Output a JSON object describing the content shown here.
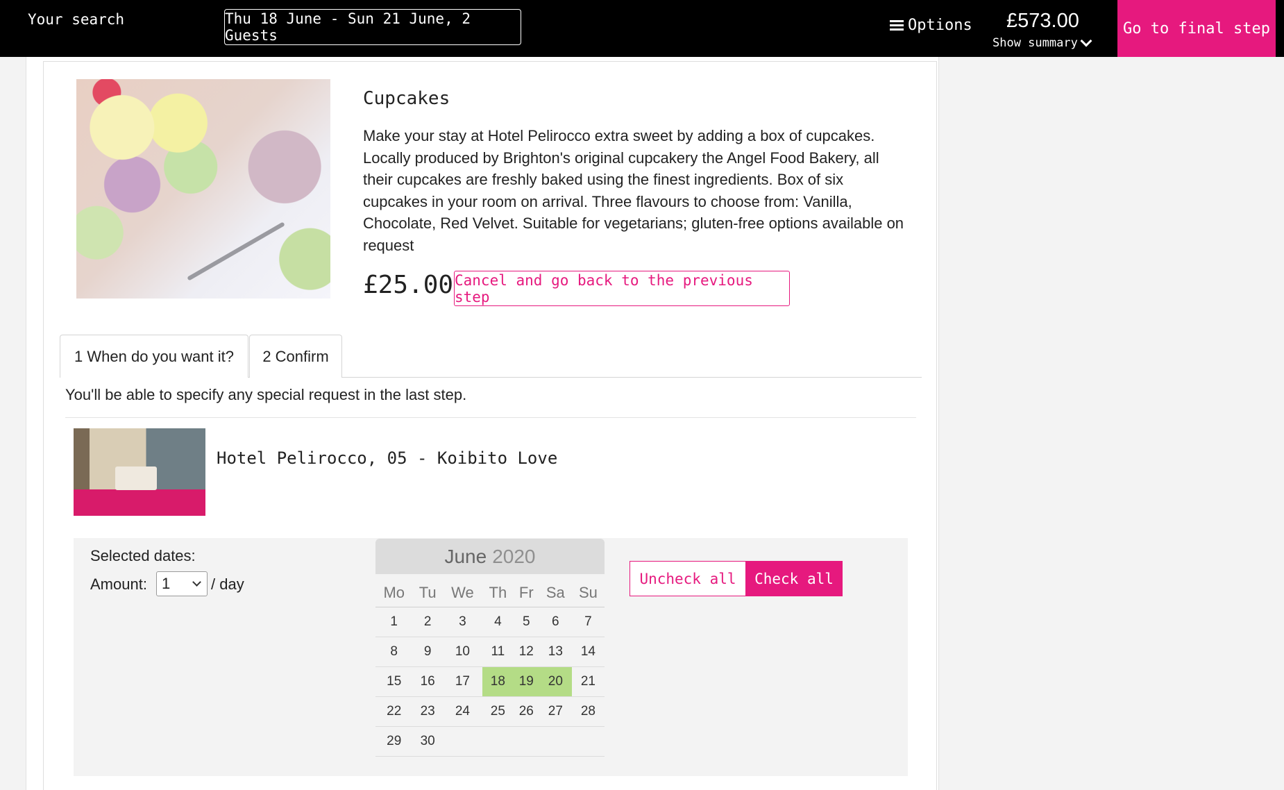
{
  "header": {
    "your_search": "Your search",
    "search_summary": "Thu 18 June - Sun 21 June, 2 Guests",
    "options_label": "Options",
    "total_price": "£573.00",
    "show_summary": "Show summary",
    "final_step": "Go to final step",
    "accent_color": "#e6197e"
  },
  "product": {
    "title": "Cupcakes",
    "description": "Make your stay at Hotel Pelirocco extra sweet by adding a box of cupcakes. Locally produced by Brighton's original cupcakery the Angel Food Bakery, all their cupcakes are freshly baked using the finest ingredients. Box of six cupcakes in your room on arrival. Three flavours to choose from: Vanilla, Chocolate, Red Velvet. Suitable for vegetarians; gluten-free options available on request",
    "price": "£25.00",
    "cancel_label": "Cancel and go back to the previous step"
  },
  "tabs": [
    {
      "label": "1 When do you want it?"
    },
    {
      "label": "2 Confirm"
    }
  ],
  "note": "You'll be able to specify any special request in the last step.",
  "room": {
    "name": "Hotel Pelirocco, 05 - Koibito Love"
  },
  "selection": {
    "selected_dates_label": "Selected dates:",
    "amount_label": "Amount:",
    "amount_value": "1",
    "per_day": "/ day"
  },
  "calendar": {
    "month": "June",
    "year": "2020",
    "weekdays": [
      "Mo",
      "Tu",
      "We",
      "Th",
      "Fr",
      "Sa",
      "Su"
    ],
    "weeks": [
      [
        "1",
        "2",
        "3",
        "4",
        "5",
        "6",
        "7"
      ],
      [
        "8",
        "9",
        "10",
        "11",
        "12",
        "13",
        "14"
      ],
      [
        "15",
        "16",
        "17",
        "18",
        "19",
        "20",
        "21"
      ],
      [
        "22",
        "23",
        "24",
        "25",
        "26",
        "27",
        "28"
      ],
      [
        "29",
        "30",
        "",
        "",
        "",
        "",
        ""
      ]
    ],
    "selected_days": [
      "18",
      "19",
      "20"
    ],
    "selected_color": "#b4dc86"
  },
  "actions": {
    "uncheck_all": "Uncheck all",
    "check_all": "Check all"
  }
}
